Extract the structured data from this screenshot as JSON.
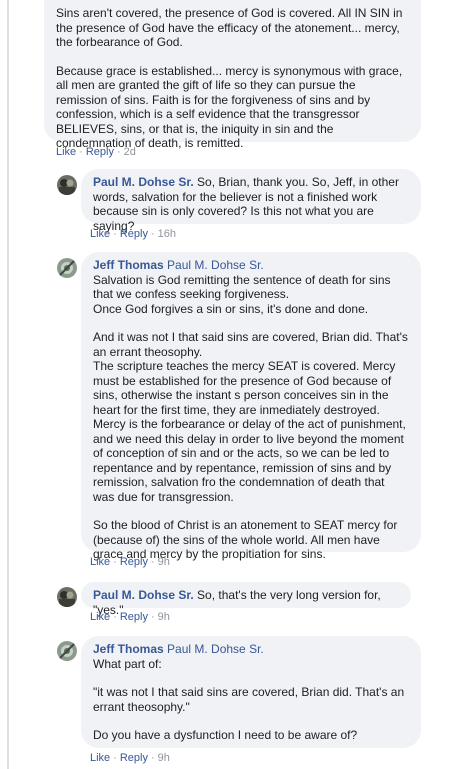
{
  "comments": [
    {
      "id": "c0",
      "author": "",
      "mention": "",
      "paragraphs": [
        "Sins aren't covered, the presence of God is covered. All IN SIN in the presence of God have the efficacy of the atonement... mercy, the forbearance of God.",
        "Because grace is established... mercy is synonymous with grace, all men are granted the gift of life so they can pursue the remission of sins. Faith is for the forgiveness of sins and by confession, which is a self evidence that the transgressor BELIEVES, sins, or that is, the iniquity in sin and the condemnation of death, is remitted."
      ],
      "like": "Like",
      "reply": "Reply",
      "time": "2d"
    },
    {
      "id": "c1",
      "author": "Paul M. Dohse Sr.",
      "mention": "",
      "paragraphs": [
        "So, Brian, thank you. So, Jeff, in other words, salvation for the believer is not a finished work because sin is only covered? Is this not what you are saying?"
      ],
      "like": "Like",
      "reply": "Reply",
      "time": "16h"
    },
    {
      "id": "c2",
      "author": "Jeff Thomas",
      "mention": "Paul M. Dohse Sr.",
      "paragraphs": [
        "Salvation is God remitting the sentence of death for sins that we confess seeking forgiveness.\nOnce God forgives a sin or sins, it's done and done.",
        "And it was not I that said sins are covered, Brian did. That's an errant theosophy.\nThe scripture teaches the mercy SEAT is covered. Mercy must be established for the presence of God because of sins, otherwise the instant s person conceives sin in the heart for the first time, they are inmediately destroyed. Mercy is the forbearance or delay of the act of punishment, and we need this delay in order to live beyond the moment of conception of sin and or the acts, so we can be led to repentance and by repentance, remission of sins and by remission, salvation fro the condemnation of death that was due for transgression.",
        "So the blood of Christ is an atonement to SEAT mercy for (because of) the sins of the whole world. All men have grace and mercy by the propitiation for sins."
      ],
      "like": "Like",
      "reply": "Reply",
      "time": "9h"
    },
    {
      "id": "c3",
      "author": "Paul M. Dohse Sr.",
      "mention": "",
      "paragraphs": [
        "So, that's the very long version for, \"yes.\""
      ],
      "like": "Like",
      "reply": "Reply",
      "time": "9h"
    },
    {
      "id": "c4",
      "author": "Jeff Thomas",
      "mention": "Paul M. Dohse Sr.",
      "paragraphs": [
        "What part of:",
        "\"it was not I that said sins are covered, Brian did. That's an errant theosophy.\"",
        "Do you have a dysfunction I need to be aware of?"
      ],
      "like": "Like",
      "reply": "Reply",
      "time": "9h"
    }
  ]
}
